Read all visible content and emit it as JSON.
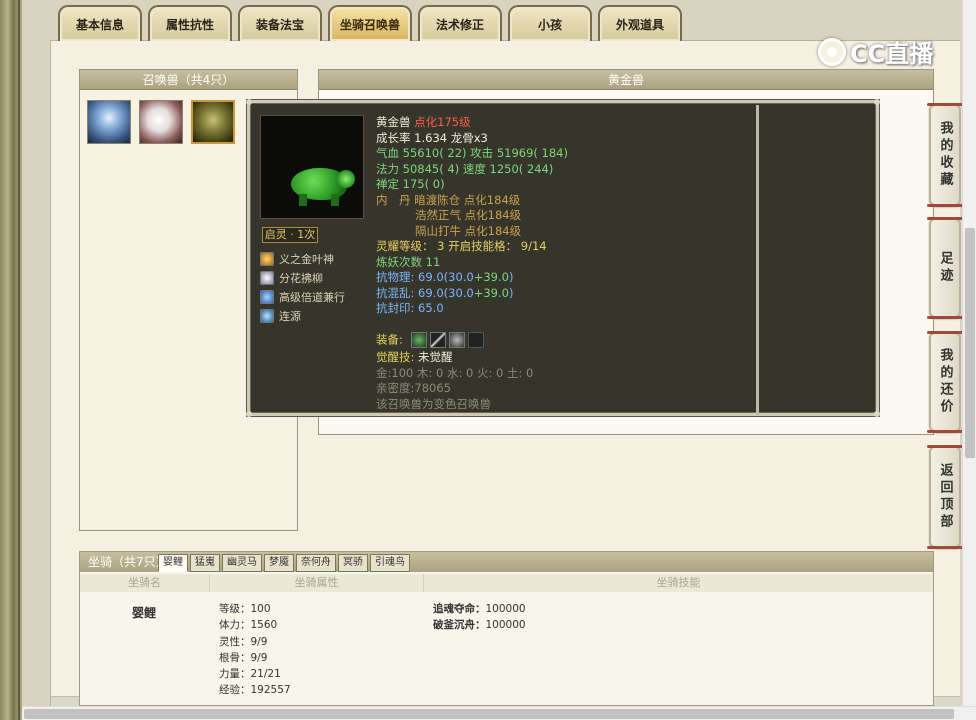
{
  "tabs": [
    {
      "label": "基本信息"
    },
    {
      "label": "属性抗性"
    },
    {
      "label": "装备法宝"
    },
    {
      "label": "坐骑召唤兽"
    },
    {
      "label": "法术修正"
    },
    {
      "label": "小孩"
    },
    {
      "label": "外观道具"
    }
  ],
  "watermark": {
    "text": "CC直播"
  },
  "summon_panel": {
    "title": "召唤兽（共4只）"
  },
  "detail_panel": {
    "title": "黄金兽"
  },
  "tooltip": {
    "name": "黄金兽",
    "tag": "点化175级",
    "growth": "成长率 1.634 龙骨x3",
    "hp_label": "气血",
    "hp_value": "55610( 22)",
    "atk_label": "攻击",
    "atk_value": "51969( 184)",
    "mp_label": "法力",
    "mp_value": "50845( 4)",
    "spd_label": "速度",
    "spd_value": "1250( 244)",
    "focus_label": "禅定",
    "focus_value": "175( 0)",
    "core_label": "内　丹",
    "cores": [
      "暗渡陈仓 点化184级",
      "浩然正气 点化184级",
      "隔山打牛 点化184级"
    ],
    "carve_label": "灵耀等级：",
    "carve_value": "3 开启技能格：",
    "carve_slots": "9/14",
    "refine": "炼妖次数 11",
    "res_phys_label": "抗物理:",
    "res_phys_base": " 69.0(30.0",
    "res_phys_plus": "+39.0",
    "res_phys_end": ")",
    "res_chaos_label": "抗混乱:",
    "res_chaos_base": " 69.0(30.0",
    "res_chaos_plus": "+39.0",
    "res_chaos_end": ")",
    "res_seal": "抗封印: 65.0",
    "equip_label": "装备:",
    "awaken_label": "觉醒技:",
    "awaken_value": "未觉醒",
    "elements": "金:100 木: 0 水: 0 火: 0 土: 0",
    "intimacy": "亲密度:78065",
    "note": "该召唤兽为变色召唤兽",
    "badge": "启灵 · 1次",
    "skills": [
      {
        "label": "义之金叶神",
        "icon": "gold-leaf-icon"
      },
      {
        "label": "分花拂柳",
        "icon": "flower-icon"
      },
      {
        "label": "高级倍道兼行",
        "icon": "wind-icon"
      },
      {
        "label": "连源",
        "icon": "chain-icon"
      }
    ]
  },
  "side_buttons": [
    {
      "label": "我的收藏"
    },
    {
      "label": "足迹"
    },
    {
      "label": "我的还价"
    },
    {
      "label": "返回顶部"
    }
  ],
  "mount": {
    "title": "坐骑（共7只）",
    "tabs": [
      "婴鲤",
      "猛嵬",
      "幽灵马",
      "梦魇",
      "奈何舟",
      "冥骄",
      "引魂鸟"
    ],
    "col_name": "坐骑名",
    "col_attr": "坐骑属性",
    "col_skill": "坐骑技能",
    "name": "婴鲤",
    "attrs": [
      "等级：100",
      "体力：1560",
      "灵性：9/9",
      "根骨：9/9",
      "力量：21/21",
      "经验：192557"
    ],
    "skills": [
      {
        "name": "追魂夺命：",
        "value": "100000"
      },
      {
        "name": "破釜沉舟：",
        "value": "100000"
      }
    ]
  }
}
